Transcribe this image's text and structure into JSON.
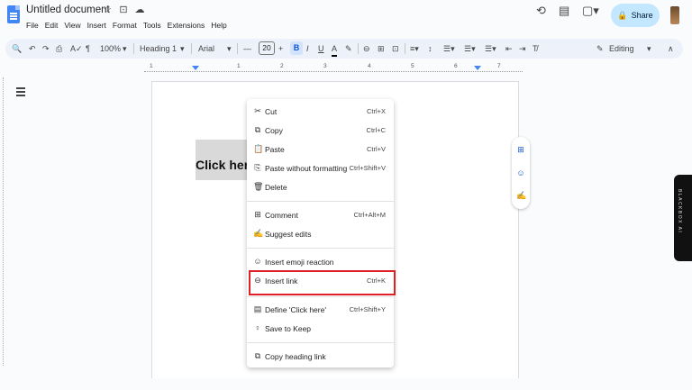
{
  "header": {
    "title": "Untitled document",
    "title_icons": [
      "☆",
      "⊡",
      "☁"
    ],
    "menu": [
      "File",
      "Edit",
      "View",
      "Insert",
      "Format",
      "Tools",
      "Extensions",
      "Help"
    ],
    "share_label": "Share",
    "icons": {
      "history": "⟲",
      "comments": "▤",
      "meet": "▢▾"
    }
  },
  "toolbar": {
    "search": "🔍",
    "undo": "↶",
    "redo": "↷",
    "print": "⎙",
    "spell": "A✓",
    "paint": "¶",
    "zoom": "100%",
    "style": "Heading 1",
    "font": "Arial",
    "minus": "—",
    "font_size": "20",
    "plus": "+",
    "bold": "B",
    "italic": "I",
    "underline": "U",
    "color": "A",
    "highlight": "✎",
    "link": "⊖",
    "comment": "⊞",
    "image": "⊡",
    "align": "≡▾",
    "linespacing": "↕",
    "checklist": "☰▾",
    "bullets": "☰▾",
    "numbered": "☰▾",
    "indent_less": "⇤",
    "indent_more": "⇥",
    "clear": "T̸",
    "editing_label": "Editing",
    "collapse": "∧"
  },
  "ruler": {
    "numbers": [
      "1",
      "1",
      "2",
      "3",
      "4",
      "5",
      "6",
      "7"
    ]
  },
  "document": {
    "selected_text": "Click here"
  },
  "context_menu": {
    "items": [
      {
        "icon": "✂",
        "label": "Cut",
        "shortcut": "Ctrl+X"
      },
      {
        "icon": "⧉",
        "label": "Copy",
        "shortcut": "Ctrl+C"
      },
      {
        "icon": "📋",
        "label": "Paste",
        "shortcut": "Ctrl+V"
      },
      {
        "icon": "⎘",
        "label": "Paste without formatting",
        "shortcut": "Ctrl+Shift+V"
      },
      {
        "icon": "🗑",
        "label": "Delete",
        "shortcut": ""
      },
      {
        "icon": "⊞",
        "label": "Comment",
        "shortcut": "Ctrl+Alt+M"
      },
      {
        "icon": "✍",
        "label": "Suggest edits",
        "shortcut": ""
      },
      {
        "icon": "☺",
        "label": "Insert emoji reaction",
        "shortcut": ""
      },
      {
        "icon": "⊖",
        "label": "Insert link",
        "shortcut": "Ctrl+K"
      },
      {
        "icon": "▤",
        "label": "Define 'Click here'",
        "shortcut": "Ctrl+Shift+Y"
      },
      {
        "icon": "♀",
        "label": "Save to Keep",
        "shortcut": ""
      },
      {
        "icon": "⧉",
        "label": "Copy heading link",
        "shortcut": ""
      }
    ]
  },
  "side_actions": {
    "add_comment": "⊞",
    "emoji": "☺",
    "suggest": "✍"
  },
  "blackbox": {
    "label": "BLACKBOX AI"
  }
}
